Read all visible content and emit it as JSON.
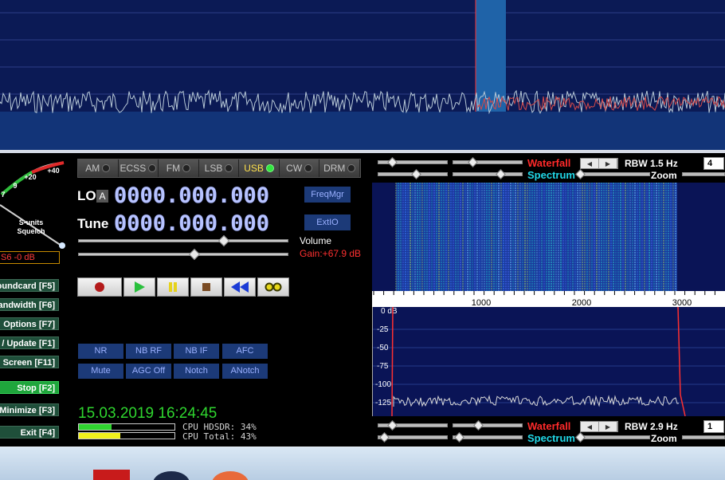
{
  "modes": [
    {
      "label": "AM",
      "active": false
    },
    {
      "label": "ECSS",
      "active": false
    },
    {
      "label": "FM",
      "active": false
    },
    {
      "label": "LSB",
      "active": false
    },
    {
      "label": "USB",
      "active": true
    },
    {
      "label": "CW",
      "active": false
    },
    {
      "label": "DRM",
      "active": false
    }
  ],
  "lo": {
    "label": "LO",
    "flag": "A",
    "value": "0000.000.000"
  },
  "tune": {
    "label": "Tune",
    "value": "0000.000.000"
  },
  "buttons": {
    "freqmgr": "FreqMgr",
    "extio": "ExtIO"
  },
  "volume": {
    "label": "Volume",
    "gain": "Gain:+67.9 dB",
    "level_fraction": 0.68
  },
  "meter": {
    "ticks": [
      "7",
      "9",
      "+20",
      "+40"
    ],
    "caption_1": "S-units",
    "caption_2": "Squelch",
    "squelch_value": "S6 -0 dB"
  },
  "side_buttons": [
    {
      "label": "oundcard [F5]",
      "active": false
    },
    {
      "label": "andwidth [F6]",
      "active": false
    },
    {
      "label": "Options [F7]",
      "active": false
    },
    {
      "label": "/ Update [F1]",
      "active": false
    },
    {
      "label": "Screen [F11]",
      "active": false
    },
    {
      "label": "Stop [F2]",
      "active": true
    },
    {
      "label": "Minimize [F3]",
      "active": false
    },
    {
      "label": "Exit [F4]",
      "active": false
    }
  ],
  "dsp": [
    "NR",
    "NB RF",
    "NB IF",
    "AFC",
    "Mute",
    "AGC Off",
    "Notch",
    "ANotch"
  ],
  "clock": "15.03.2019 16:24:45",
  "cpu": {
    "hdsdr_label": "CPU HDSDR: 34%",
    "total_label": "CPU Total: 43%",
    "hdsdr": 34,
    "total": 43,
    "hdsdr_color": "#30d630",
    "total_color": "#f2f21c"
  },
  "waterfall_controls": {
    "waterfall_label": "Waterfall",
    "spectrum_label": "Spectrum",
    "rbw_label": "RBW",
    "rbw_value": "1.5 Hz",
    "zoom_label": "Zoom",
    "box_value": "4"
  },
  "spectrum_controls": {
    "waterfall_label": "Waterfall",
    "spectrum_label": "Spectrum",
    "rbw_label": "RBW",
    "rbw_value": "2.9 Hz",
    "zoom_label": "Zoom",
    "box_value": "1"
  },
  "freq_axis": [
    "1000",
    "2000",
    "3000"
  ],
  "db_axis": [
    "0 dB",
    "-25",
    "-50",
    "-75",
    "-100",
    "-125"
  ],
  "colors": {
    "accent_red": "#ff2a2a",
    "accent_cyan": "#21d8e8",
    "background_blue": "#0a1456"
  }
}
